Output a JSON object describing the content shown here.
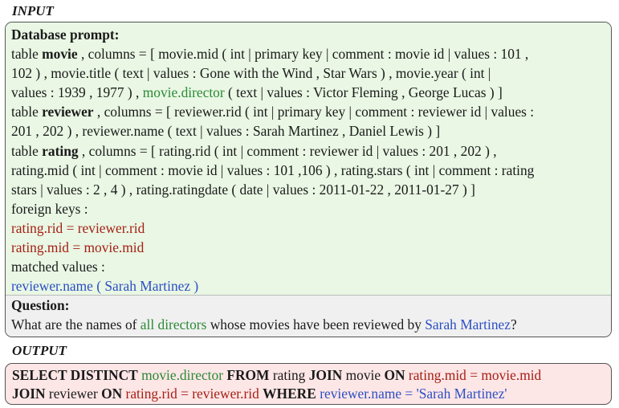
{
  "input": {
    "title": "INPUT",
    "prompt_heading": "Database prompt:",
    "lines": {
      "l1_pre": "table ",
      "l1_table": "movie",
      "l1_post": " , columns = [ movie.mid ( int | primary key | comment : movie id | values : 101 ,",
      "l2": "102 ) , movie.title ( text | values : Gone with the Wind , Star Wars ) , movie.year ( int |",
      "l3_pre": "values : 1939 , 1977 ) , ",
      "l3_col": "movie.director",
      "l3_post": " ( text | values : Victor Fleming , George Lucas ) ]",
      "l4_pre": "table ",
      "l4_table": "reviewer",
      "l4_post": " , columns = [ reviewer.rid ( int | primary key | comment : reviewer id | values :",
      "l5": "201 , 202 ) , reviewer.name ( text | values : Sarah Martinez , Daniel Lewis ) ]",
      "l6_pre": "table ",
      "l6_table": "rating",
      "l6_post": " , columns = [ rating.rid ( int | comment : reviewer id | values : 201 , 202 ) ,",
      "l7": "rating.mid ( int | comment : movie id | values : 101 ,106 ) , rating.stars ( int | comment : rating",
      "l8": "stars | values : 2 , 4 ) , rating.ratingdate ( date | values : 2011-01-22 , 2011-01-27 ) ]",
      "l9": "foreign keys :",
      "l10": "rating.rid = reviewer.rid",
      "l11": "rating.mid = movie.mid",
      "l12": "matched values :",
      "l13": "reviewer.name ( Sarah Martinez )"
    },
    "question_heading": "Question:",
    "question": {
      "pre": "What are the names of ",
      "highlight1": "all directors",
      "mid": " whose movies have been reviewed by ",
      "highlight2": "Sarah Martinez",
      "post": "?"
    }
  },
  "output": {
    "title": "OUTPUT",
    "sql": {
      "kw_select": "SELECT DISTINCT",
      "col_director": " movie.director ",
      "kw_from": "FROM",
      "t_rating": " rating ",
      "kw_join1": "JOIN",
      "t_movie": " movie ",
      "kw_on1": "ON",
      "cond1": " rating.mid  =  movie.mid",
      "kw_join2": "JOIN",
      "t_reviewer": " reviewer ",
      "kw_on2": "ON",
      "cond2": " rating.rid  =  reviewer.rid ",
      "kw_where": "WHERE",
      "cond3": " reviewer.name  =  'Sarah Martinez'"
    }
  },
  "colors": {
    "prompt_bg": "#e9f7e4",
    "question_bg": "#f0f0f0",
    "output_bg": "#fde6e6",
    "green": "#2b8a36",
    "red": "#a51f14",
    "blue": "#2c4fc4"
  }
}
